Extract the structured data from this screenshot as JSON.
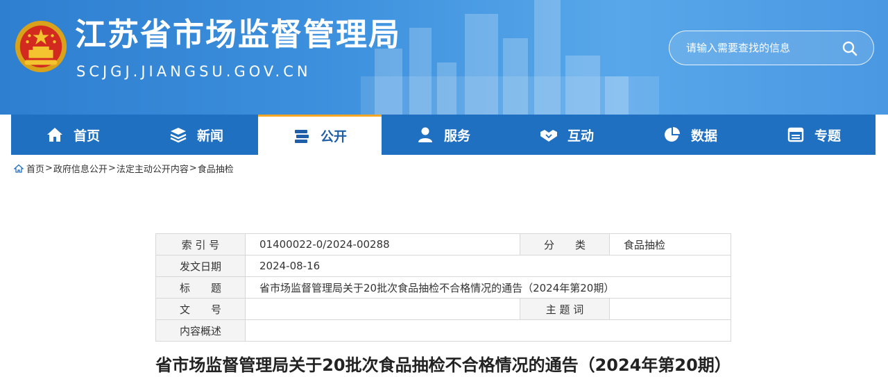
{
  "header": {
    "site_name": "江苏省市场监督管理局",
    "site_domain": "SCJGJ.JIANGSU.GOV.CN",
    "search_placeholder": "请输入需要查找的信息"
  },
  "nav": {
    "items": [
      {
        "label": "首页",
        "icon": "home-icon"
      },
      {
        "label": "新闻",
        "icon": "layers-icon"
      },
      {
        "label": "公开",
        "icon": "books-icon",
        "active": true
      },
      {
        "label": "服务",
        "icon": "person-icon"
      },
      {
        "label": "互动",
        "icon": "handshake-icon"
      },
      {
        "label": "数据",
        "icon": "pie-chart-icon"
      },
      {
        "label": "专题",
        "icon": "window-icon"
      }
    ]
  },
  "breadcrumb": {
    "items": [
      "首页",
      "政府信息公开",
      "法定主动公开内容",
      "食品抽检"
    ],
    "separator": ">"
  },
  "meta": {
    "index_no_label": "索 引 号",
    "index_no": "01400022-0/2024-00288",
    "category_label": "分　　类",
    "category": "食品抽检",
    "date_label": "发文日期",
    "date": "2024-08-16",
    "title_label": "标　　题",
    "title": "省市场监督管理局关于20批次食品抽检不合格情况的通告（2024年第20期）",
    "doc_no_label": "文　　号",
    "doc_no": "",
    "keywords_label": "主 题 词",
    "keywords": "",
    "summary_label": "内容概述",
    "summary": ""
  },
  "document": {
    "title": "省市场监督管理局关于20批次食品抽检不合格情况的通告（2024年第20期）"
  },
  "colors": {
    "header_blue": "#3b8fdc",
    "nav_blue": "#1f70c1",
    "active_accent": "#f5a623"
  }
}
